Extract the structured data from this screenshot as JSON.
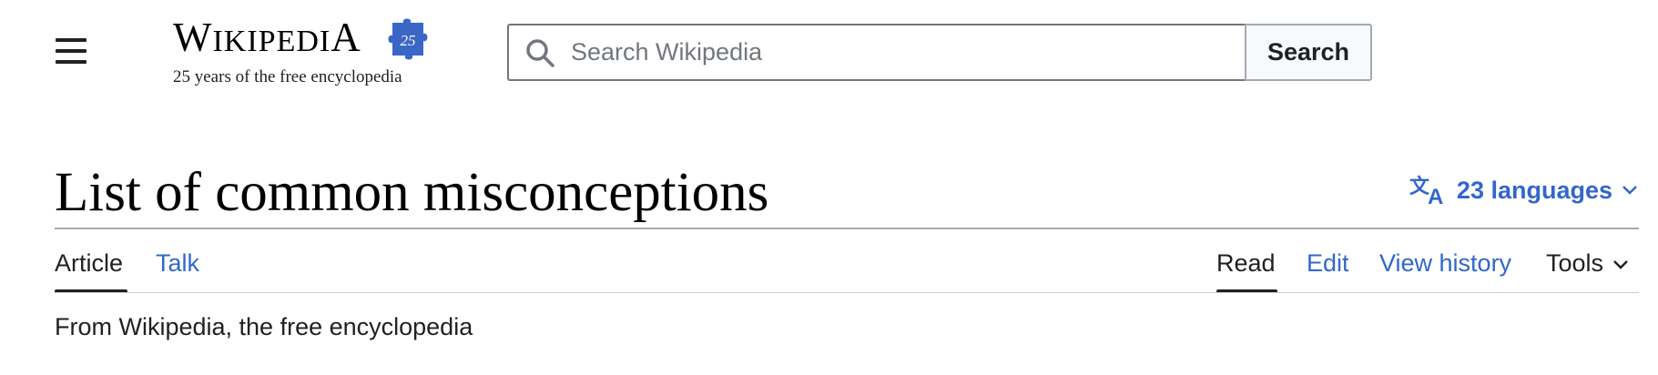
{
  "header": {
    "menu_label": "Main menu",
    "logo": {
      "wordmark_first": "W",
      "wordmark_mid": "IKIPEDI",
      "wordmark_last": "A",
      "badge_text": "25",
      "tagline": "25 years of the free encyclopedia"
    },
    "search": {
      "placeholder": "Search Wikipedia",
      "value": "",
      "button_label": "Search"
    }
  },
  "page": {
    "title": "List of common misconceptions",
    "languages_label": "23 languages",
    "from_text": "From Wikipedia, the free encyclopedia"
  },
  "tabs": {
    "left": [
      {
        "label": "Article",
        "selected": true
      },
      {
        "label": "Talk",
        "selected": false
      }
    ],
    "right": [
      {
        "label": "Read",
        "selected": true
      },
      {
        "label": "Edit",
        "selected": false
      },
      {
        "label": "View history",
        "selected": false
      },
      {
        "label": "Tools",
        "selected": false
      }
    ]
  },
  "colors": {
    "link": "#3366cc",
    "text": "#202122",
    "border": "#a2a9b1",
    "puzzle": "#3a67c6"
  },
  "icons": [
    "menu-icon",
    "puzzle-icon",
    "search-icon",
    "language-icon",
    "chevron-down-icon"
  ]
}
